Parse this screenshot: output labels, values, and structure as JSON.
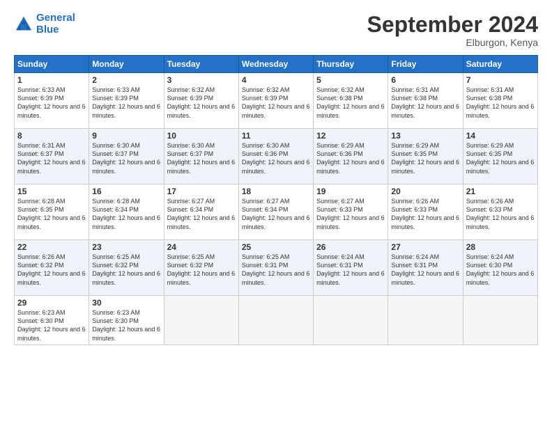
{
  "logo": {
    "line1": "General",
    "line2": "Blue"
  },
  "title": "September 2024",
  "location": "Elburgon, Kenya",
  "headers": [
    "Sunday",
    "Monday",
    "Tuesday",
    "Wednesday",
    "Thursday",
    "Friday",
    "Saturday"
  ],
  "weeks": [
    [
      {
        "day": "1",
        "sunrise": "6:33 AM",
        "sunset": "6:39 PM",
        "daylight": "12 hours and 6 minutes."
      },
      {
        "day": "2",
        "sunrise": "6:33 AM",
        "sunset": "6:39 PM",
        "daylight": "12 hours and 6 minutes."
      },
      {
        "day": "3",
        "sunrise": "6:32 AM",
        "sunset": "6:39 PM",
        "daylight": "12 hours and 6 minutes."
      },
      {
        "day": "4",
        "sunrise": "6:32 AM",
        "sunset": "6:39 PM",
        "daylight": "12 hours and 6 minutes."
      },
      {
        "day": "5",
        "sunrise": "6:32 AM",
        "sunset": "6:38 PM",
        "daylight": "12 hours and 6 minutes."
      },
      {
        "day": "6",
        "sunrise": "6:31 AM",
        "sunset": "6:38 PM",
        "daylight": "12 hours and 6 minutes."
      },
      {
        "day": "7",
        "sunrise": "6:31 AM",
        "sunset": "6:38 PM",
        "daylight": "12 hours and 6 minutes."
      }
    ],
    [
      {
        "day": "8",
        "sunrise": "6:31 AM",
        "sunset": "6:37 PM",
        "daylight": "12 hours and 6 minutes."
      },
      {
        "day": "9",
        "sunrise": "6:30 AM",
        "sunset": "6:37 PM",
        "daylight": "12 hours and 6 minutes."
      },
      {
        "day": "10",
        "sunrise": "6:30 AM",
        "sunset": "6:37 PM",
        "daylight": "12 hours and 6 minutes."
      },
      {
        "day": "11",
        "sunrise": "6:30 AM",
        "sunset": "6:36 PM",
        "daylight": "12 hours and 6 minutes."
      },
      {
        "day": "12",
        "sunrise": "6:29 AM",
        "sunset": "6:36 PM",
        "daylight": "12 hours and 6 minutes."
      },
      {
        "day": "13",
        "sunrise": "6:29 AM",
        "sunset": "6:35 PM",
        "daylight": "12 hours and 6 minutes."
      },
      {
        "day": "14",
        "sunrise": "6:29 AM",
        "sunset": "6:35 PM",
        "daylight": "12 hours and 6 minutes."
      }
    ],
    [
      {
        "day": "15",
        "sunrise": "6:28 AM",
        "sunset": "6:35 PM",
        "daylight": "12 hours and 6 minutes."
      },
      {
        "day": "16",
        "sunrise": "6:28 AM",
        "sunset": "6:34 PM",
        "daylight": "12 hours and 6 minutes."
      },
      {
        "day": "17",
        "sunrise": "6:27 AM",
        "sunset": "6:34 PM",
        "daylight": "12 hours and 6 minutes."
      },
      {
        "day": "18",
        "sunrise": "6:27 AM",
        "sunset": "6:34 PM",
        "daylight": "12 hours and 6 minutes."
      },
      {
        "day": "19",
        "sunrise": "6:27 AM",
        "sunset": "6:33 PM",
        "daylight": "12 hours and 6 minutes."
      },
      {
        "day": "20",
        "sunrise": "6:26 AM",
        "sunset": "6:33 PM",
        "daylight": "12 hours and 6 minutes."
      },
      {
        "day": "21",
        "sunrise": "6:26 AM",
        "sunset": "6:33 PM",
        "daylight": "12 hours and 6 minutes."
      }
    ],
    [
      {
        "day": "22",
        "sunrise": "6:26 AM",
        "sunset": "6:32 PM",
        "daylight": "12 hours and 6 minutes."
      },
      {
        "day": "23",
        "sunrise": "6:25 AM",
        "sunset": "6:32 PM",
        "daylight": "12 hours and 6 minutes."
      },
      {
        "day": "24",
        "sunrise": "6:25 AM",
        "sunset": "6:32 PM",
        "daylight": "12 hours and 6 minutes."
      },
      {
        "day": "25",
        "sunrise": "6:25 AM",
        "sunset": "6:31 PM",
        "daylight": "12 hours and 6 minutes."
      },
      {
        "day": "26",
        "sunrise": "6:24 AM",
        "sunset": "6:31 PM",
        "daylight": "12 hours and 6 minutes."
      },
      {
        "day": "27",
        "sunrise": "6:24 AM",
        "sunset": "6:31 PM",
        "daylight": "12 hours and 6 minutes."
      },
      {
        "day": "28",
        "sunrise": "6:24 AM",
        "sunset": "6:30 PM",
        "daylight": "12 hours and 6 minutes."
      }
    ],
    [
      {
        "day": "29",
        "sunrise": "6:23 AM",
        "sunset": "6:30 PM",
        "daylight": "12 hours and 6 minutes."
      },
      {
        "day": "30",
        "sunrise": "6:23 AM",
        "sunset": "6:30 PM",
        "daylight": "12 hours and 6 minutes."
      },
      null,
      null,
      null,
      null,
      null
    ]
  ]
}
